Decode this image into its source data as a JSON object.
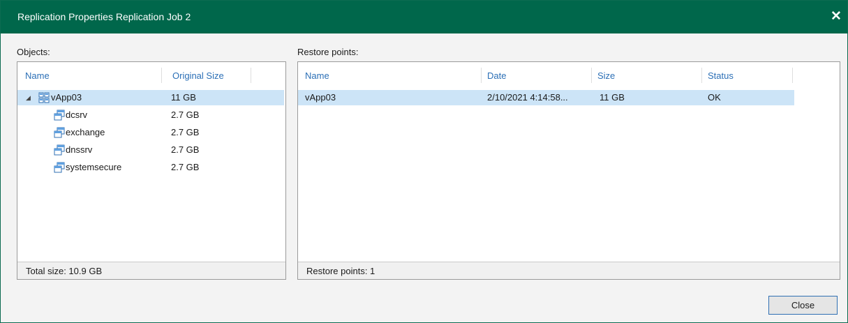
{
  "window": {
    "title": "Replication Properties Replication Job 2",
    "close_glyph": "✕"
  },
  "objects": {
    "label": "Objects:",
    "columns": [
      "Name",
      "Original Size"
    ],
    "rows": [
      {
        "name": "vApp03",
        "size": "11 GB",
        "icon": "vapp-icon",
        "expanded": true,
        "selected": true
      },
      {
        "name": "dcsrv",
        "size": "2.7 GB",
        "icon": "vm-icon"
      },
      {
        "name": "exchange",
        "size": "2.7 GB",
        "icon": "vm-icon"
      },
      {
        "name": "dnssrv",
        "size": "2.7 GB",
        "icon": "vm-icon"
      },
      {
        "name": "systemsecure",
        "size": "2.7 GB",
        "icon": "vm-icon"
      }
    ],
    "footer": "Total size: 10.9 GB"
  },
  "restore_points": {
    "label": "Restore points:",
    "columns": [
      "Name",
      "Date",
      "Size",
      "Status"
    ],
    "rows": [
      {
        "name": "vApp03",
        "date": "2/10/2021 4:14:58...",
        "size": "11 GB",
        "status": "OK",
        "selected": true
      }
    ],
    "footer": "Restore points: 1"
  },
  "buttons": {
    "close": "Close"
  },
  "colors": {
    "titlebar": "#00674b",
    "header_text": "#2b6fb6",
    "selection": "#cce4f7"
  }
}
